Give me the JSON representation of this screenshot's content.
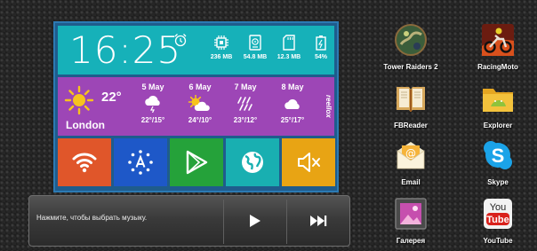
{
  "clock": {
    "time": "16:25"
  },
  "stats": [
    {
      "icon": "cpu-icon",
      "value": "236 MB"
    },
    {
      "icon": "storage-icon",
      "value": "54.8 MB"
    },
    {
      "icon": "sd-card-icon",
      "value": "12.3 MB"
    },
    {
      "icon": "battery-icon",
      "value": "54%"
    }
  ],
  "weather": {
    "current_temp": "22°",
    "city": "London",
    "brand": "reellox",
    "forecast": [
      {
        "date": "5 May",
        "icon": "cloud-rain-icon",
        "range": "22°/15°"
      },
      {
        "date": "6 May",
        "icon": "partly-cloudy-icon",
        "range": "24°/10°"
      },
      {
        "date": "7 May",
        "icon": "rain-icon",
        "range": "23°/12°"
      },
      {
        "date": "8 May",
        "icon": "cloud-icon",
        "range": "25°/17°"
      }
    ]
  },
  "tiles": [
    {
      "name": "wifi",
      "icon": "wifi-icon",
      "color": "#e0562a"
    },
    {
      "name": "auto-brightness",
      "icon": "auto-brightness-icon",
      "color": "#1e58c8"
    },
    {
      "name": "play-store",
      "icon": "play-store-icon",
      "color": "#25a23a"
    },
    {
      "name": "browser",
      "icon": "globe-icon",
      "color": "#19afb1"
    },
    {
      "name": "sound",
      "icon": "mute-icon",
      "color": "#e8a414"
    }
  ],
  "music": {
    "hint": "Нажмите, чтобы выбрать музыку."
  },
  "apps": [
    {
      "label": "Tower Raiders 2"
    },
    {
      "label": "RacingMoto"
    },
    {
      "label": "FBReader"
    },
    {
      "label": "Explorer"
    },
    {
      "label": "Email"
    },
    {
      "label": "Skype"
    },
    {
      "label": "Галерея"
    },
    {
      "label": "YouTube"
    }
  ]
}
